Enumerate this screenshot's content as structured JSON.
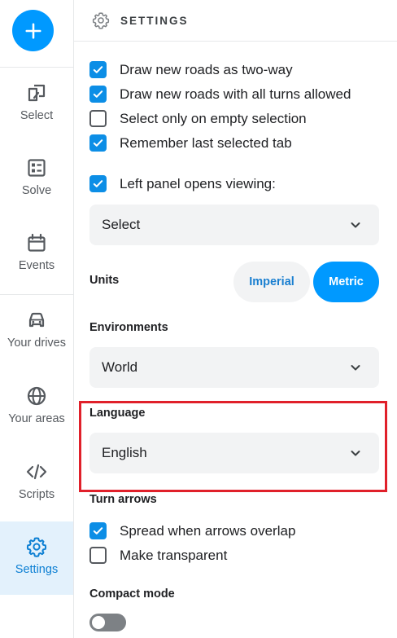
{
  "rail": {
    "add_label": "",
    "items": [
      {
        "label": "Select",
        "icon": "select-icon"
      },
      {
        "label": "Solve",
        "icon": "solve-icon"
      },
      {
        "label": "Events",
        "icon": "events-icon"
      },
      {
        "label": "Your drives",
        "icon": "car-icon"
      },
      {
        "label": "Your areas",
        "icon": "globe-icon"
      },
      {
        "label": "Scripts",
        "icon": "code-icon"
      },
      {
        "label": "Settings",
        "icon": "gear-icon"
      }
    ]
  },
  "header": {
    "title": "SETTINGS",
    "icon": "gear-icon"
  },
  "general": {
    "two_way": {
      "label": "Draw new roads as two-way",
      "checked": true
    },
    "all_turns": {
      "label": "Draw new roads with all turns allowed",
      "checked": true
    },
    "select_empty": {
      "label": "Select only on empty selection",
      "checked": false
    },
    "remember_tab": {
      "label": "Remember last selected tab",
      "checked": true
    },
    "left_panel": {
      "label": "Left panel opens viewing:",
      "checked": true
    },
    "left_panel_value": "Select"
  },
  "units": {
    "label": "Units",
    "imperial": "Imperial",
    "metric": "Metric",
    "selected": "Metric"
  },
  "environments": {
    "label": "Environments",
    "value": "World"
  },
  "language": {
    "label": "Language",
    "value": "English"
  },
  "turn_arrows": {
    "label": "Turn arrows",
    "spread": {
      "label": "Spread when arrows overlap",
      "checked": true
    },
    "transparent": {
      "label": "Make transparent",
      "checked": false
    }
  },
  "compact": {
    "label": "Compact mode",
    "enabled": false
  },
  "colors": {
    "accent": "#0099ff",
    "highlight": "#e0202a",
    "active_bg": "#e3f1fc"
  }
}
